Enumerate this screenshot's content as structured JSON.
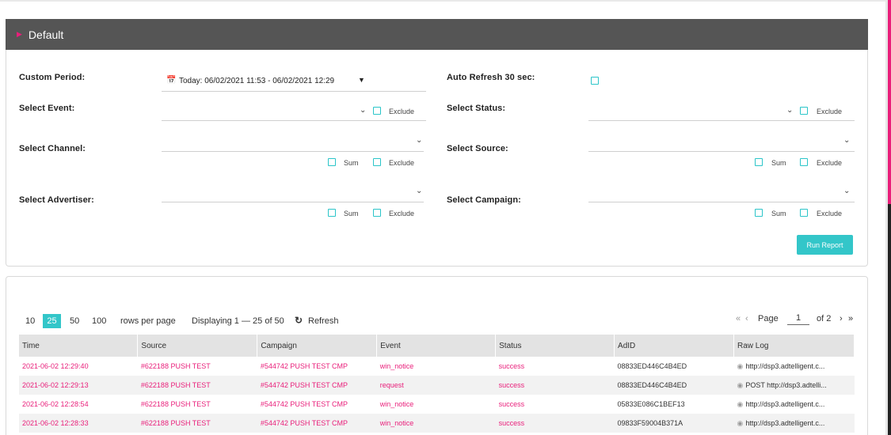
{
  "panel": {
    "title": "Default",
    "toggle_icon": "triangle-right-icon"
  },
  "filters": {
    "custom_period": {
      "label": "Custom Period:",
      "value": "Today: 06/02/2021 11:53 - 06/02/2021 12:29"
    },
    "auto_refresh": {
      "label": "Auto Refresh 30 sec:"
    },
    "event": {
      "label": "Select Event:",
      "exclude": "Exclude"
    },
    "status": {
      "label": "Select Status:",
      "exclude": "Exclude"
    },
    "channel": {
      "label": "Select Channel:",
      "sum": "Sum",
      "exclude": "Exclude"
    },
    "source": {
      "label": "Select Source:",
      "sum": "Sum",
      "exclude": "Exclude"
    },
    "advertiser": {
      "label": "Select Advertiser:",
      "sum": "Sum",
      "exclude": "Exclude"
    },
    "campaign": {
      "label": "Select Campaign:",
      "sum": "Sum",
      "exclude": "Exclude"
    },
    "run_button": "Run Report"
  },
  "pagination": {
    "sizes": [
      "10",
      "25",
      "50",
      "100"
    ],
    "active_size": "25",
    "rows_per_page": "rows per page",
    "displaying": "Displaying 1 — 25 of 50",
    "refresh": "Refresh",
    "page_label": "Page",
    "page_value": "1",
    "of_total": "of 2",
    "first": "«",
    "prev": "‹",
    "next": "›",
    "last": "»"
  },
  "table": {
    "columns": [
      "Time",
      "Source",
      "Campaign",
      "Event",
      "Status",
      "AdID",
      "Raw Log"
    ],
    "rows": [
      [
        "2021-06-02 12:29:40",
        "#622188 PUSH TEST",
        "#544742 PUSH TEST CMP",
        "win_notice",
        "success",
        "08833ED446C4B4ED",
        "http://dsp3.adtelligent.c..."
      ],
      [
        "2021-06-02 12:29:13",
        "#622188 PUSH TEST",
        "#544742 PUSH TEST CMP",
        "request",
        "success",
        "08833ED446C4B4ED",
        "POST http://dsp3.adtelli..."
      ],
      [
        "2021-06-02 12:28:54",
        "#622188 PUSH TEST",
        "#544742 PUSH TEST CMP",
        "win_notice",
        "success",
        "05833E086C1BEF13",
        "http://dsp3.adtelligent.c..."
      ],
      [
        "2021-06-02 12:28:33",
        "#622188 PUSH TEST",
        "#544742 PUSH TEST CMP",
        "win_notice",
        "success",
        "09833F59004B371A",
        "http://dsp3.adtelligent.c..."
      ]
    ]
  },
  "colors": {
    "accent": "#e91e7a",
    "teal": "#33c6c9",
    "header_bg": "#555555"
  }
}
